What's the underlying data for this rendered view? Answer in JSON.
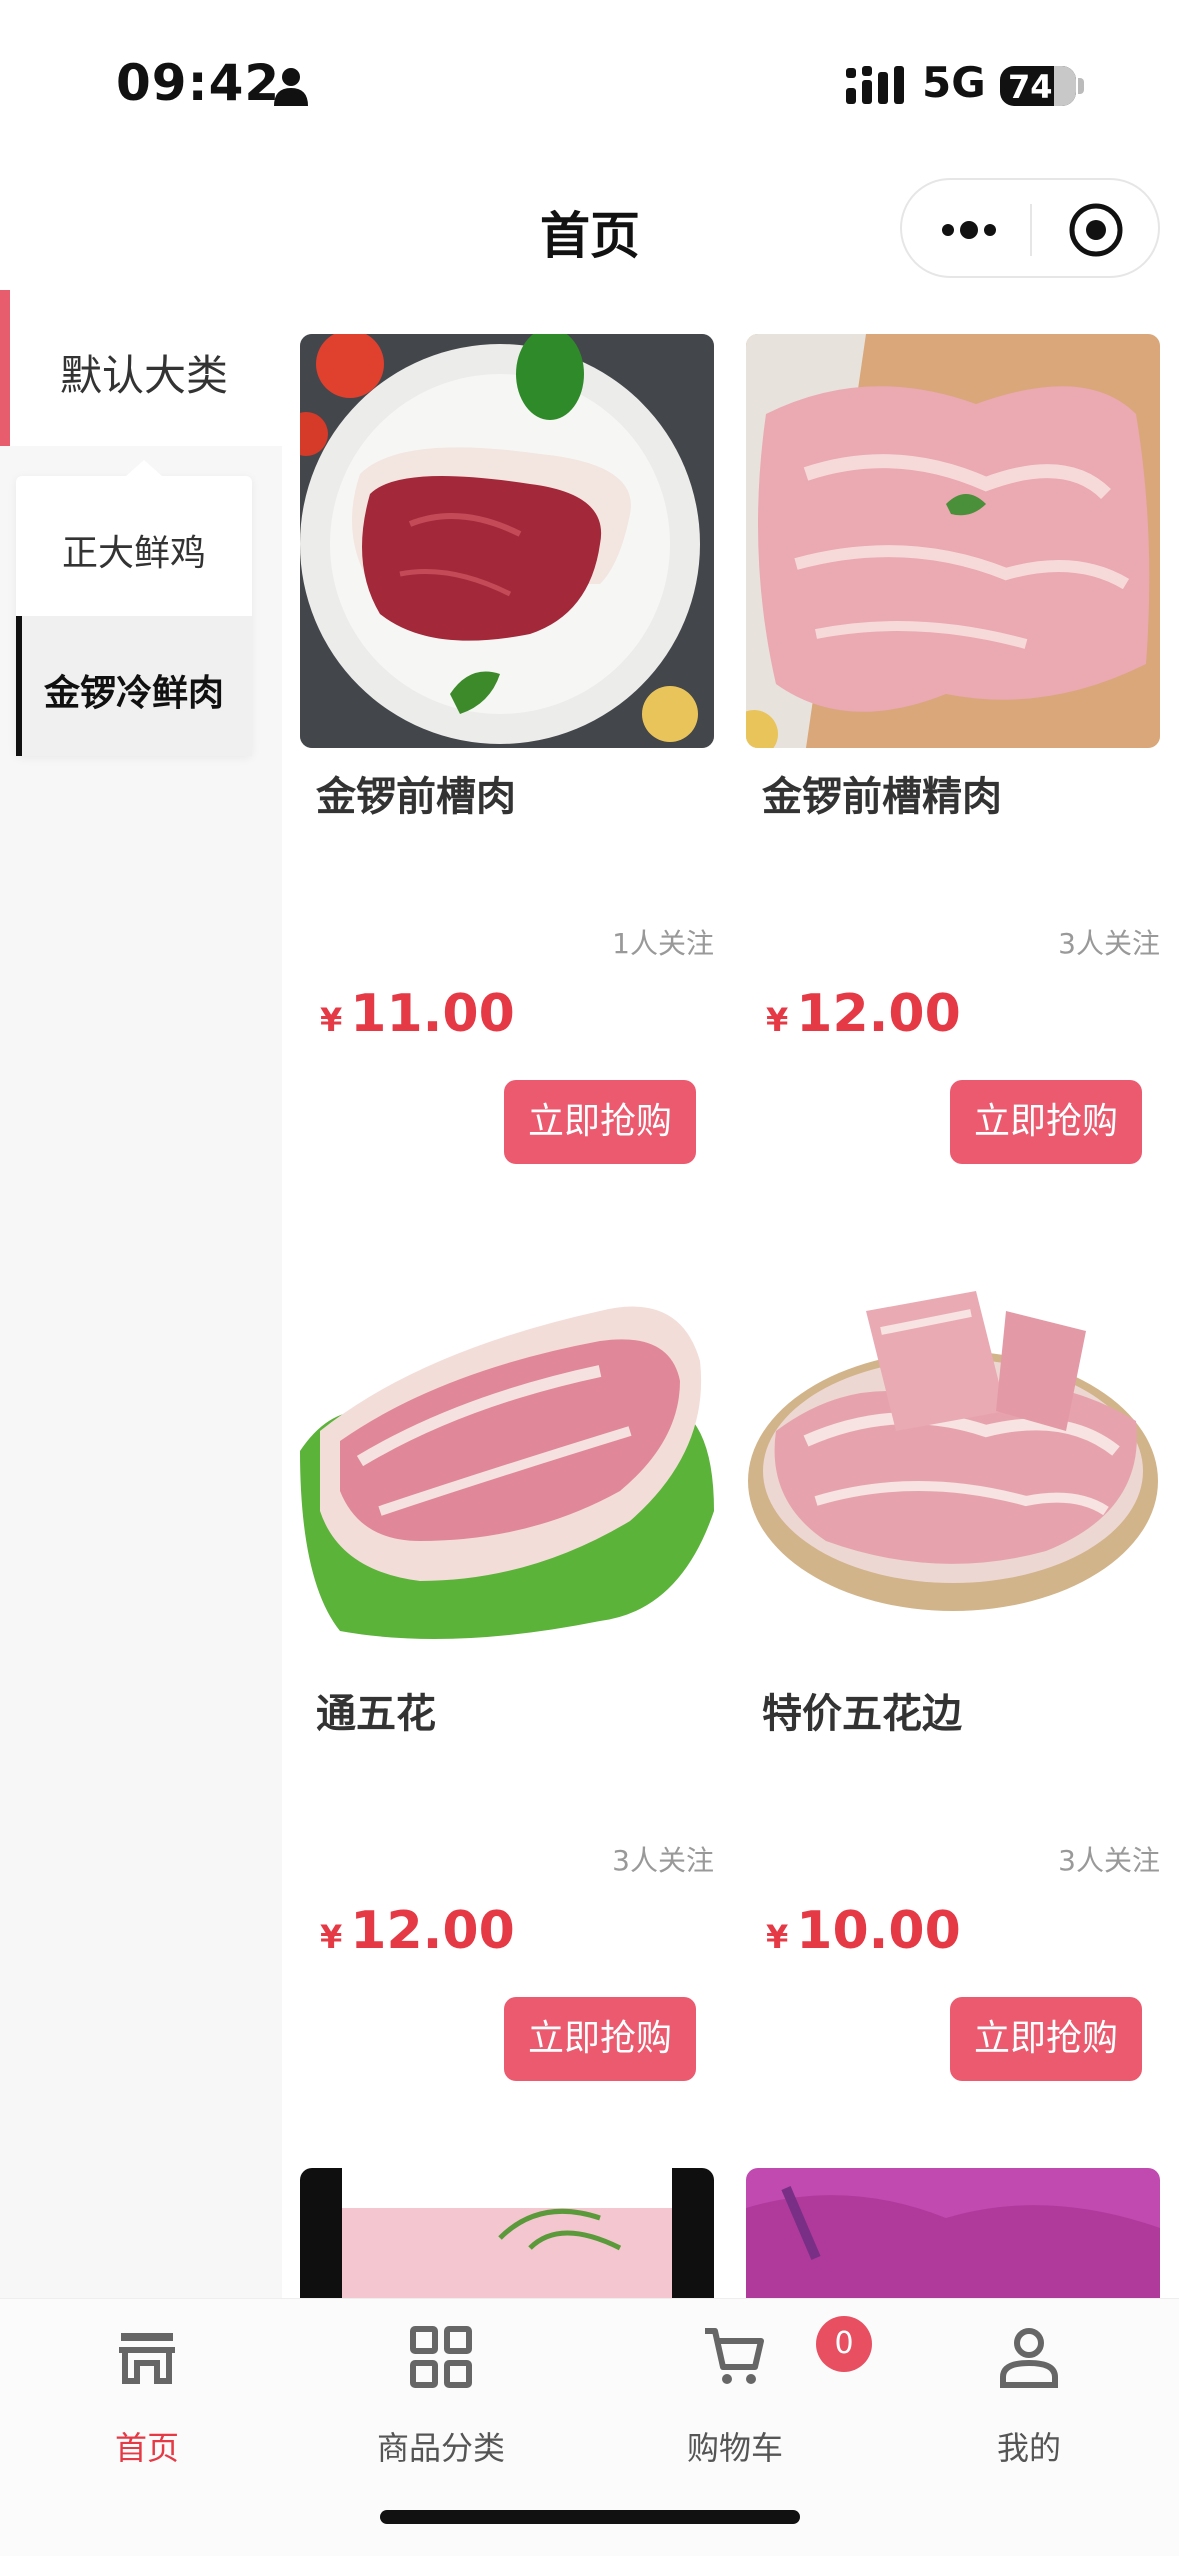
{
  "status": {
    "time": "09:42",
    "network": "5G",
    "battery": "74"
  },
  "nav": {
    "title": "首页"
  },
  "sidebar": {
    "main_category": "默认大类",
    "sub_categories": [
      {
        "label": "正大鲜鸡",
        "selected": false
      },
      {
        "label": "金锣冷鲜肉",
        "selected": true
      }
    ]
  },
  "products": [
    {
      "name": "金锣前槽肉",
      "followers": "1人关注",
      "currency": "¥",
      "price": "11.00",
      "buy_label": "立即抢购",
      "image": "lean-pork-on-plate"
    },
    {
      "name": "金锣前槽精肉",
      "followers": "3人关注",
      "currency": "¥",
      "price": "12.00",
      "buy_label": "立即抢购",
      "image": "pork-slice-on-board"
    },
    {
      "name": "通五花",
      "followers": "3人关注",
      "currency": "¥",
      "price": "12.00",
      "buy_label": "立即抢购",
      "image": "pork-belly-on-lettuce"
    },
    {
      "name": "特价五花边",
      "followers": "3人关注",
      "currency": "¥",
      "price": "10.00",
      "buy_label": "立即抢购",
      "image": "pork-belly-strips-bowl"
    }
  ],
  "tabbar": {
    "items": [
      {
        "label": "首页",
        "icon": "store-icon",
        "active": true
      },
      {
        "label": "商品分类",
        "icon": "category-grid-icon",
        "active": false
      },
      {
        "label": "购物车",
        "icon": "cart-icon",
        "active": false
      },
      {
        "label": "我的",
        "icon": "user-icon",
        "active": false
      }
    ],
    "cart_count": "0"
  },
  "colors": {
    "accent": "#e53945",
    "button": "#ec5a6f",
    "sidebar_bar": "#e85d6e"
  }
}
